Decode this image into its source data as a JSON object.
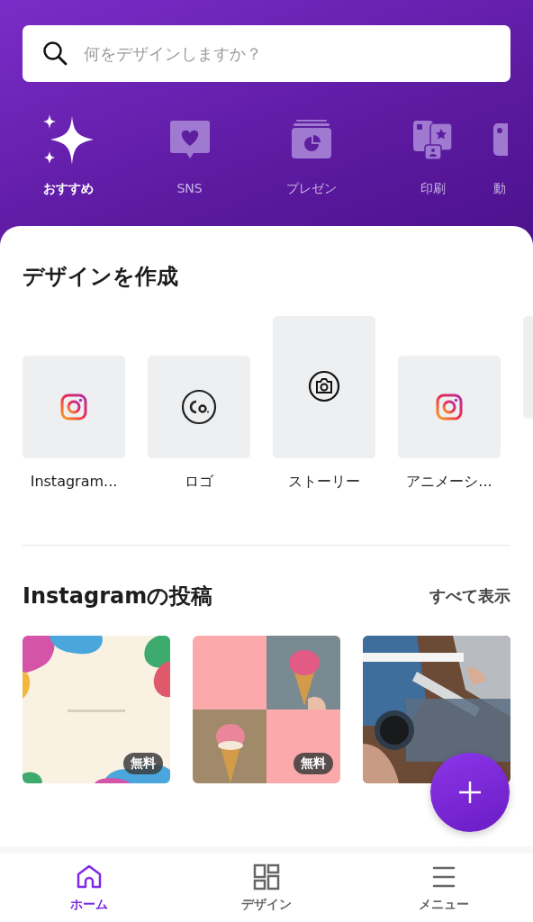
{
  "search": {
    "placeholder": "何をデザインしますか？"
  },
  "categories": [
    {
      "label": "おすすめ",
      "kind": "sparkle",
      "selected": true
    },
    {
      "label": "SNS",
      "kind": "social",
      "selected": false
    },
    {
      "label": "プレゼン",
      "kind": "presentation",
      "selected": false
    },
    {
      "label": "印刷",
      "kind": "print",
      "selected": false
    },
    {
      "label": "動",
      "kind": "video",
      "selected": false
    }
  ],
  "create": {
    "title": "デザインを作成",
    "items": [
      {
        "label": "Instagram...",
        "kind": "instagram"
      },
      {
        "label": "ロゴ",
        "kind": "logo"
      },
      {
        "label": "ストーリー",
        "kind": "camera"
      },
      {
        "label": "アニメーシ...",
        "kind": "instagram"
      },
      {
        "kind": "blank"
      }
    ]
  },
  "instagram_posts": {
    "title": "Instagramの投稿",
    "link": "すべて表示",
    "templates": [
      {
        "kind": "picture",
        "badge": "無料"
      },
      {
        "kind": "picture",
        "badge": "無料"
      },
      {
        "kind": "picture"
      }
    ]
  },
  "bottom_nav": [
    {
      "label": "ホーム",
      "kind": "home",
      "selected": true
    },
    {
      "label": "デザイン",
      "kind": "designs",
      "selected": false
    },
    {
      "label": "メニュー",
      "kind": "menu",
      "selected": false
    }
  ]
}
